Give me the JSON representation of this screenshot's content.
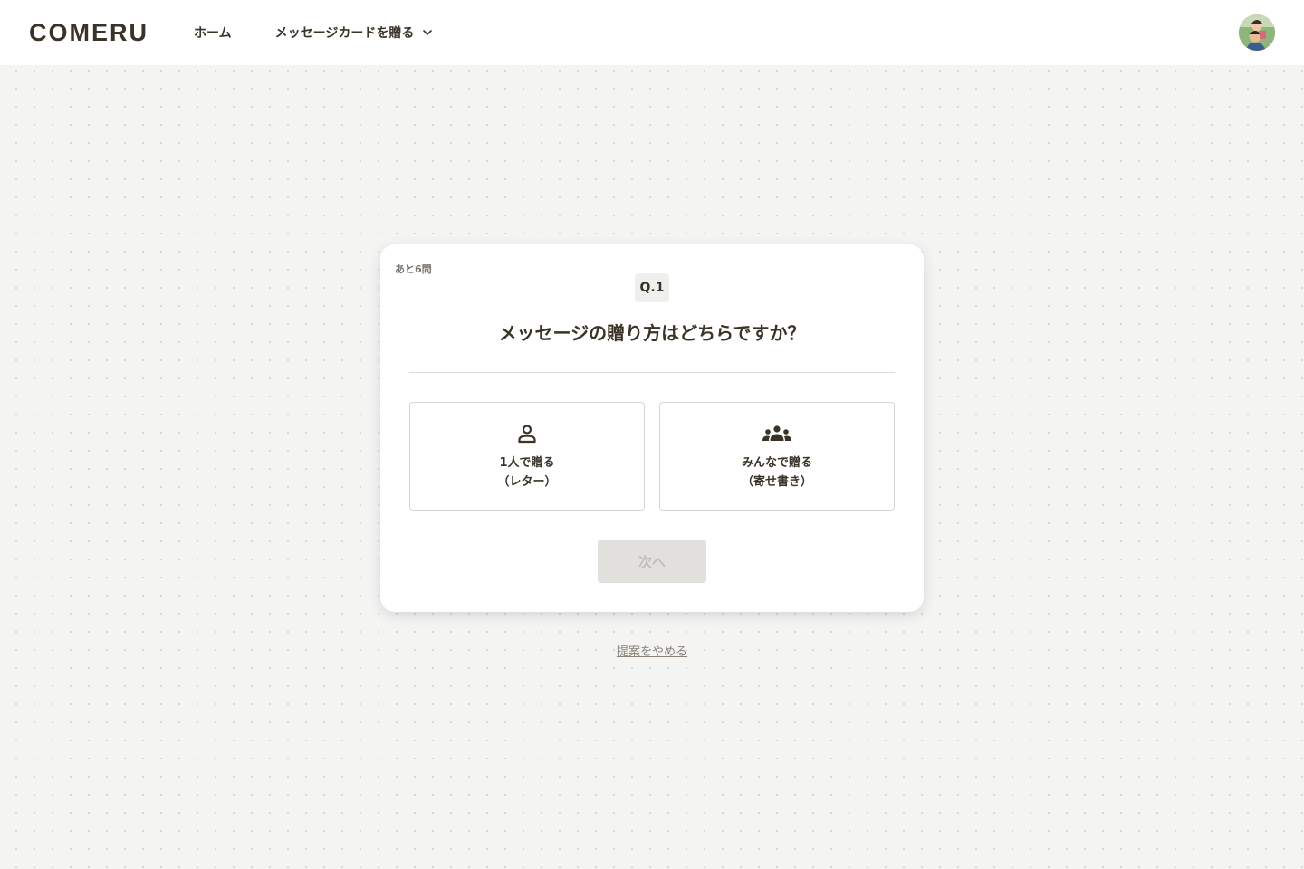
{
  "header": {
    "logo": "COMERU",
    "nav": {
      "home": "ホーム",
      "send_card": "メッセージカードを贈る"
    },
    "avatar_icon": "user-avatar-photo"
  },
  "quiz": {
    "remaining": "あと6問",
    "question_number": "Q.1",
    "question": "メッセージの贈り方はどちらですか？",
    "options": [
      {
        "icon": "person-icon",
        "line1": "1人で贈る",
        "line2": "（レター）"
      },
      {
        "icon": "group-icon",
        "line1": "みんなで贈る",
        "line2": "（寄せ書き）"
      }
    ],
    "next_label": "次へ",
    "next_disabled": true
  },
  "cancel_label": "提案をやめる",
  "colors": {
    "text": "#3a3327",
    "background": "#f4f4f3",
    "card": "#ffffff",
    "disabled_button": "#e2e0dd"
  }
}
